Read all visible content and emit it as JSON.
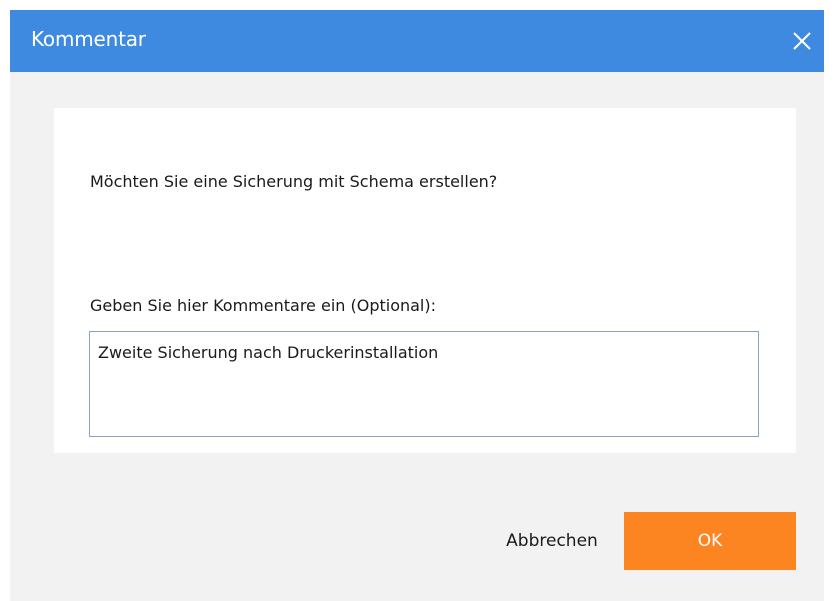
{
  "dialog": {
    "title": "Kommentar",
    "close_icon": "close-icon",
    "question": "Möchten Sie eine Sicherung mit Schema erstellen?",
    "comment_label": "Geben Sie hier Kommentare ein (Optional):",
    "comment_value": "Zweite Sicherung nach Druckerinstallation",
    "cancel_label": "Abbrechen",
    "ok_label": "OK"
  },
  "colors": {
    "titlebar": "#3e8ae1",
    "ok_button": "#fd8521",
    "background": "#f2f2f2"
  }
}
